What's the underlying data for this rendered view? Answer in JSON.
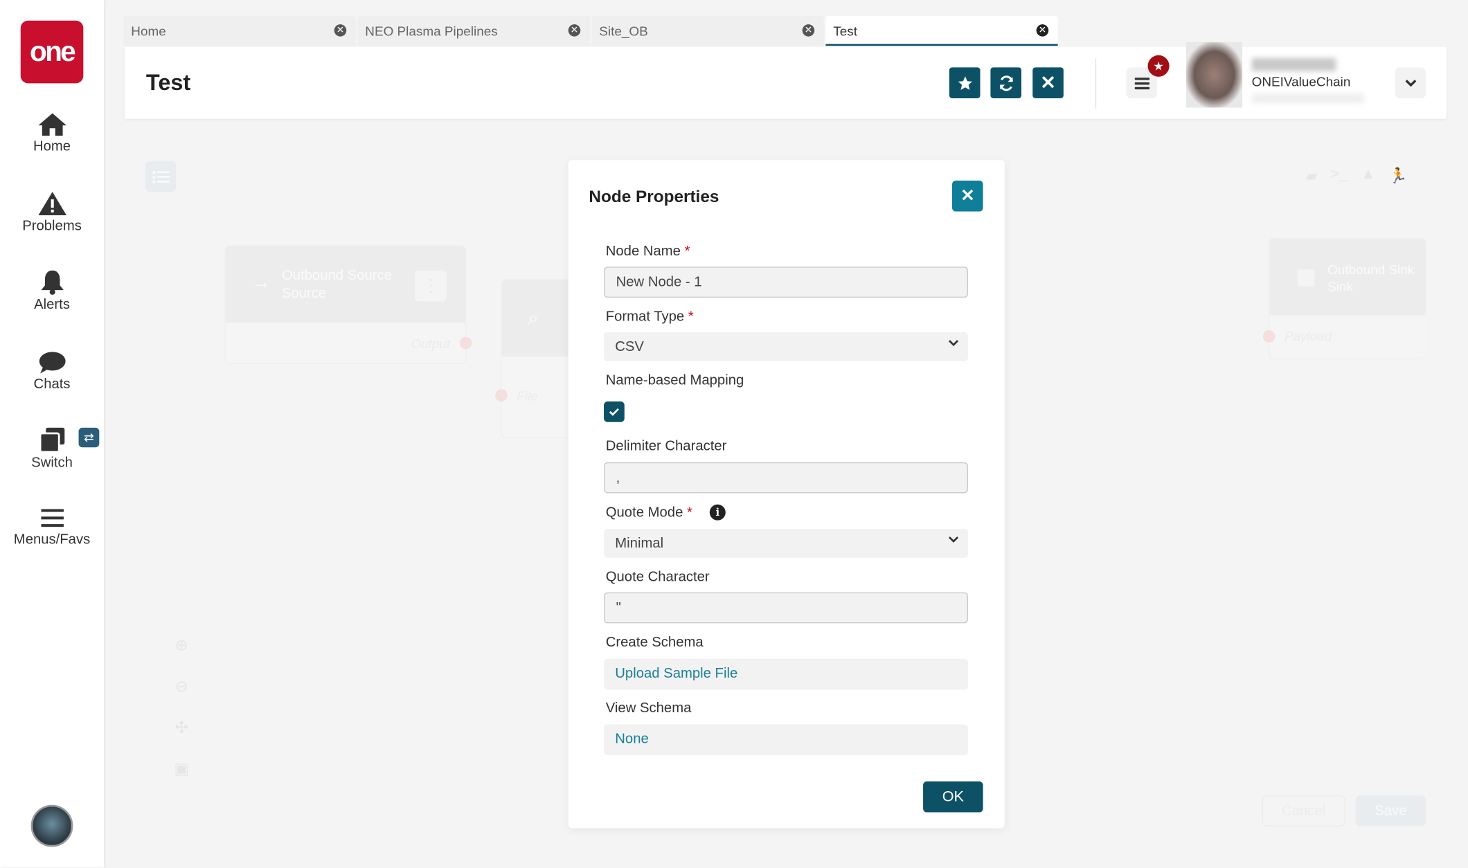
{
  "sidebar": {
    "logo": "one",
    "items": [
      {
        "label": "Home",
        "icon": "home-icon"
      },
      {
        "label": "Problems",
        "icon": "warning-icon"
      },
      {
        "label": "Alerts",
        "icon": "bell-icon"
      },
      {
        "label": "Chats",
        "icon": "chat-icon"
      },
      {
        "label": "Switch",
        "icon": "switch-icon"
      },
      {
        "label": "Menus/Favs",
        "icon": "menu-icon"
      }
    ]
  },
  "tabs": [
    {
      "label": "Home"
    },
    {
      "label": "NEO Plasma Pipelines"
    },
    {
      "label": "Site_OB"
    },
    {
      "label": "Test",
      "active": true
    }
  ],
  "header": {
    "title": "Test",
    "org": "ONEIValueChain"
  },
  "canvas": {
    "nodes": [
      {
        "title": "Outbound Source",
        "subtitle": "Source",
        "port": "Output"
      },
      {
        "port": "File"
      },
      {
        "title": "Outbound Sink",
        "subtitle": "Sink",
        "port": "Payload"
      }
    ],
    "cancel_label": "Cancel",
    "save_label": "Save"
  },
  "modal": {
    "title": "Node Properties",
    "node_name": {
      "label": "Node Name",
      "value": "New Node - 1"
    },
    "format_type": {
      "label": "Format Type",
      "value": "CSV"
    },
    "name_mapping": {
      "label": "Name-based Mapping",
      "checked": true
    },
    "delimiter": {
      "label": "Delimiter Character",
      "value": ","
    },
    "quote_mode": {
      "label": "Quote Mode",
      "value": "Minimal"
    },
    "quote_char": {
      "label": "Quote Character",
      "value": "\""
    },
    "create_schema": {
      "label": "Create Schema",
      "link": "Upload Sample File"
    },
    "view_schema": {
      "label": "View Schema",
      "value": "None"
    },
    "required_mark": "*",
    "ok_label": "OK"
  },
  "colors": {
    "brand": "#c8102e",
    "primary": "#0d5167",
    "accent": "#0f7f99"
  }
}
